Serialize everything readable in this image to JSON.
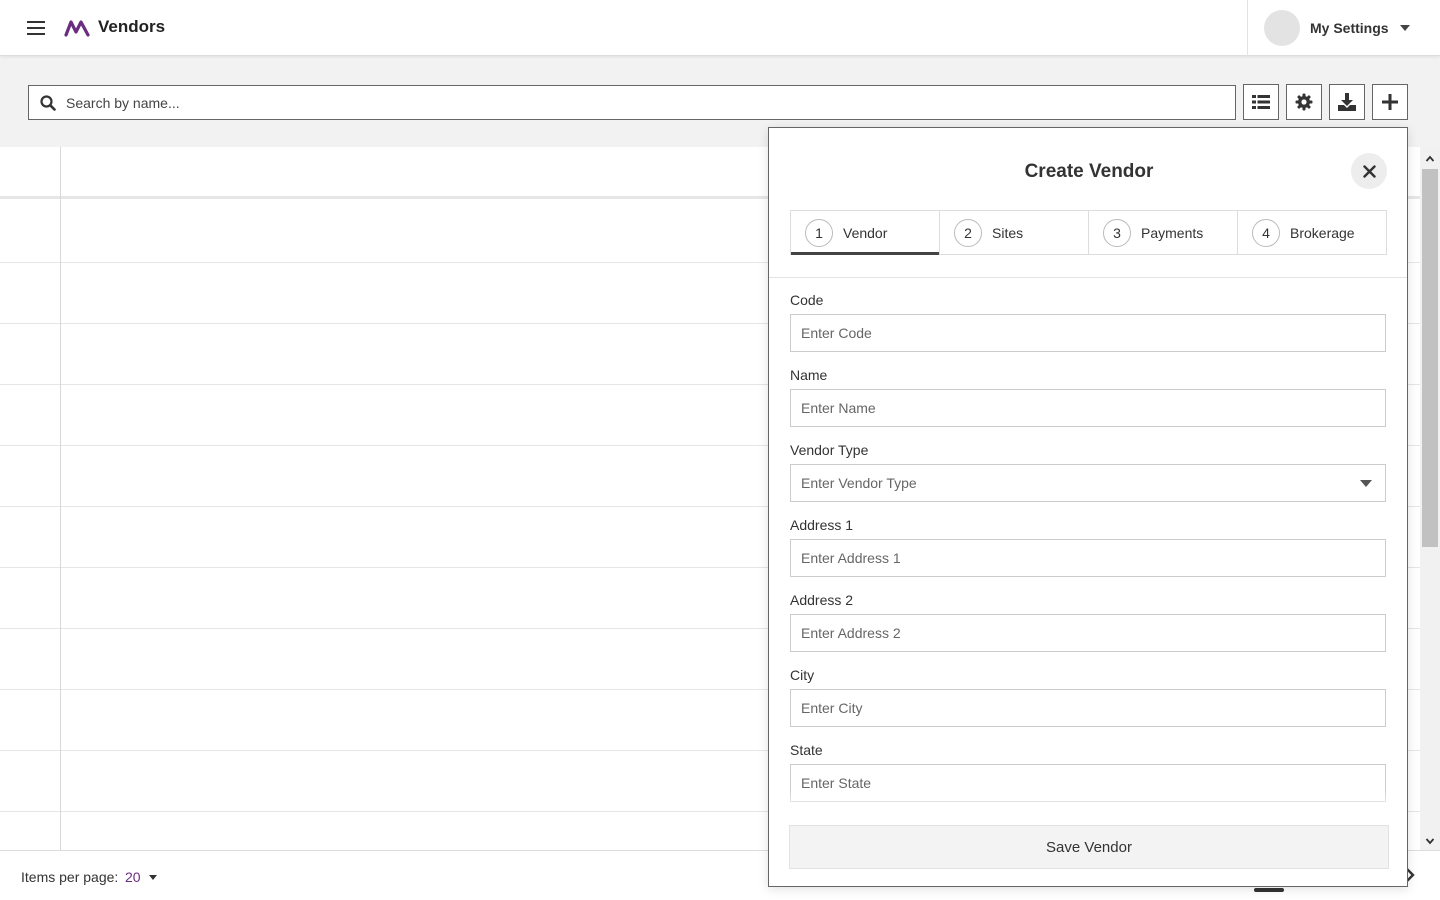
{
  "header": {
    "title": "Vendors",
    "settings_label": "My Settings",
    "brand_color": "#6b2d80"
  },
  "search": {
    "placeholder": "Search by name..."
  },
  "toolbar": {
    "buttons": [
      "list-icon",
      "gear-icon",
      "download-icon",
      "plus-icon"
    ]
  },
  "footer": {
    "items_per_page_label": "Items per page:",
    "items_per_page_value": "20"
  },
  "create_panel": {
    "title": "Create Vendor",
    "steps": [
      {
        "number": "1",
        "label": "Vendor",
        "active": true
      },
      {
        "number": "2",
        "label": "Sites",
        "active": false
      },
      {
        "number": "3",
        "label": "Payments",
        "active": false
      },
      {
        "number": "4",
        "label": "Brokerage",
        "active": false
      }
    ],
    "fields": [
      {
        "label": "Code",
        "placeholder": "Enter Code"
      },
      {
        "label": "Name",
        "placeholder": "Enter Name"
      },
      {
        "label": "Vendor Type",
        "placeholder": "Enter Vendor Type"
      },
      {
        "label": "Address 1",
        "placeholder": "Enter Address 1"
      },
      {
        "label": "Address 2",
        "placeholder": "Enter Address 2"
      },
      {
        "label": "City",
        "placeholder": "Enter City"
      },
      {
        "label": "State",
        "placeholder": "Enter State"
      }
    ],
    "save_label": "Save Vendor"
  }
}
